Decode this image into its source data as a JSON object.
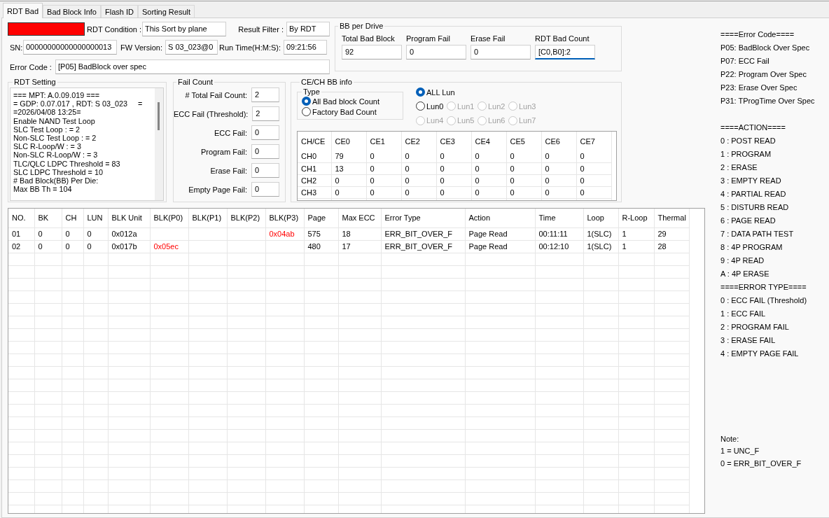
{
  "tabs": [
    {
      "label": "RDT Bad",
      "selected": true
    },
    {
      "label": "Bad Block Info",
      "selected": false
    },
    {
      "label": "Flash ID",
      "selected": false
    },
    {
      "label": "Sorting Result",
      "selected": false
    }
  ],
  "status_indicator": {
    "color": "#ff0000"
  },
  "rdt_condition": {
    "label": "RDT Condition :",
    "value": "This Sort by plane"
  },
  "result_filter": {
    "label": "Result Filter :",
    "value": "By RDT"
  },
  "sn": {
    "label": "SN:",
    "value": "00000000000000000013"
  },
  "fw_version": {
    "label": "FW Version:",
    "value": "S 03_023@0"
  },
  "run_time": {
    "label": "Run Time(H:M:S):",
    "value": "09:21:56"
  },
  "error_code": {
    "label": "Error Code :",
    "value": "[P05] BadBlock over spec"
  },
  "bb_per_drive": {
    "title": "BB per Drive",
    "fields": [
      {
        "label": "Total Bad Block",
        "value": "92",
        "focused": false
      },
      {
        "label": "Program Fail",
        "value": "0",
        "focused": false
      },
      {
        "label": "Erase Fail",
        "value": "0",
        "focused": false
      },
      {
        "label": "RDT Bad Count",
        "value": "[C0,B0]:2",
        "focused": true
      }
    ]
  },
  "rdt_setting": {
    "title": "RDT Setting",
    "lines": [
      "=== MPT: A.0.09.019 ===",
      "= GDP: 0.07.017 , RDT: S 03_023     =",
      "=2026/04/08 13:25=",
      "Enable NAND Test Loop",
      "SLC Test Loop : = 2",
      "Non-SLC Test Loop : = 2",
      "SLC R-Loop/W : = 3",
      "Non-SLC R-Loop/W : = 3",
      "TLC/QLC LDPC Threshold = 83",
      "SLC LDPC Threshold = 10",
      "# Bad Block(BB) Per Die:",
      "Max BB Th = 104"
    ]
  },
  "fail_count": {
    "title": "Fail Count",
    "fields": [
      {
        "label": "# Total Fail Count:",
        "value": "2"
      },
      {
        "label": "ECC Fail (Threshold):",
        "value": "2"
      },
      {
        "label": "ECC Fail:",
        "value": "0"
      },
      {
        "label": "Program Fail:",
        "value": "0"
      },
      {
        "label": "Erase Fail:",
        "value": "0"
      },
      {
        "label": "Empty Page Fail:",
        "value": "0"
      }
    ]
  },
  "ce_ch_bb_info": {
    "title": "CE/CH BB info",
    "type_group": {
      "title": "Type",
      "options": [
        {
          "label": "All Bad block Count",
          "selected": true
        },
        {
          "label": "Factory Bad Count",
          "selected": false
        }
      ]
    },
    "lun_all": {
      "label": "ALL Lun",
      "selected": true,
      "disabled": false
    },
    "lun_options": [
      {
        "label": "Lun0",
        "selected": false,
        "disabled": false
      },
      {
        "label": "Lun1",
        "selected": false,
        "disabled": true
      },
      {
        "label": "Lun2",
        "selected": false,
        "disabled": true
      },
      {
        "label": "Lun3",
        "selected": false,
        "disabled": true
      },
      {
        "label": "Lun4",
        "selected": false,
        "disabled": true
      },
      {
        "label": "Lun5",
        "selected": false,
        "disabled": true
      },
      {
        "label": "Lun6",
        "selected": false,
        "disabled": true
      },
      {
        "label": "Lun7",
        "selected": false,
        "disabled": true
      }
    ],
    "table": {
      "columns": [
        "CH/CE",
        "CE0",
        "CE1",
        "CE2",
        "CE3",
        "CE4",
        "CE5",
        "CE6",
        "CE7"
      ],
      "rows": [
        [
          "CH0",
          "79",
          "0",
          "0",
          "0",
          "0",
          "0",
          "0",
          "0"
        ],
        [
          "CH1",
          "13",
          "0",
          "0",
          "0",
          "0",
          "0",
          "0",
          "0"
        ],
        [
          "CH2",
          "0",
          "0",
          "0",
          "0",
          "0",
          "0",
          "0",
          "0"
        ],
        [
          "CH3",
          "0",
          "0",
          "0",
          "0",
          "0",
          "0",
          "0",
          "0"
        ]
      ]
    }
  },
  "results_table": {
    "columns": [
      "NO.",
      "BK",
      "CH",
      "LUN",
      "BLK Unit",
      "BLK(P0)",
      "BLK(P1)",
      "BLK(P2)",
      "BLK(P3)",
      "Page",
      "Max ECC",
      "Error Type",
      "Action",
      "Time",
      "Loop",
      "R-Loop",
      "Thermal"
    ],
    "rows": [
      {
        "cells": [
          "01",
          "0",
          "0",
          "0",
          "0x012a",
          "",
          "",
          "",
          {
            "text": "0x04ab",
            "color": "#ff0000"
          },
          "575",
          "18",
          "ERR_BIT_OVER_F",
          "Page Read",
          "00:11:11",
          "1(SLC)",
          "1",
          "29"
        ]
      },
      {
        "cells": [
          "02",
          "0",
          "0",
          "0",
          "0x017b",
          {
            "text": "0x05ec",
            "color": "#ff0000"
          },
          "",
          "",
          "",
          "480",
          "17",
          "ERR_BIT_OVER_F",
          "Page Read",
          "00:12:10",
          "1(SLC)",
          "1",
          "28"
        ]
      }
    ]
  },
  "legend": {
    "sections": [
      [
        "====Error Code====",
        "P05: BadBlock Over Spec",
        "P07: ECC Fail",
        "P22: Program Over Spec",
        "P23: Erase Over Spec",
        "P31: TProgTime Over Spec"
      ],
      [
        "====ACTION====",
        "0 : POST READ",
        "1 : PROGRAM",
        "2 : ERASE",
        "3 : EMPTY READ",
        "4 : PARTIAL READ",
        "5 : DISTURB READ",
        "6 : PAGE READ",
        "7 : DATA PATH TEST",
        "8 : 4P PROGRAM",
        "9 : 4P READ",
        "A : 4P ERASE",
        "====ERROR TYPE====",
        "0 : ECC FAIL (Threshold)",
        "1 : ECC FAIL",
        "2 : PROGRAM FAIL",
        "3 : ERASE FAIL",
        "4 : EMPTY PAGE FAIL"
      ]
    ],
    "note_lines": [
      "Note:",
      "1 = UNC_F",
      "0 = ERR_BIT_OVER_F"
    ]
  }
}
